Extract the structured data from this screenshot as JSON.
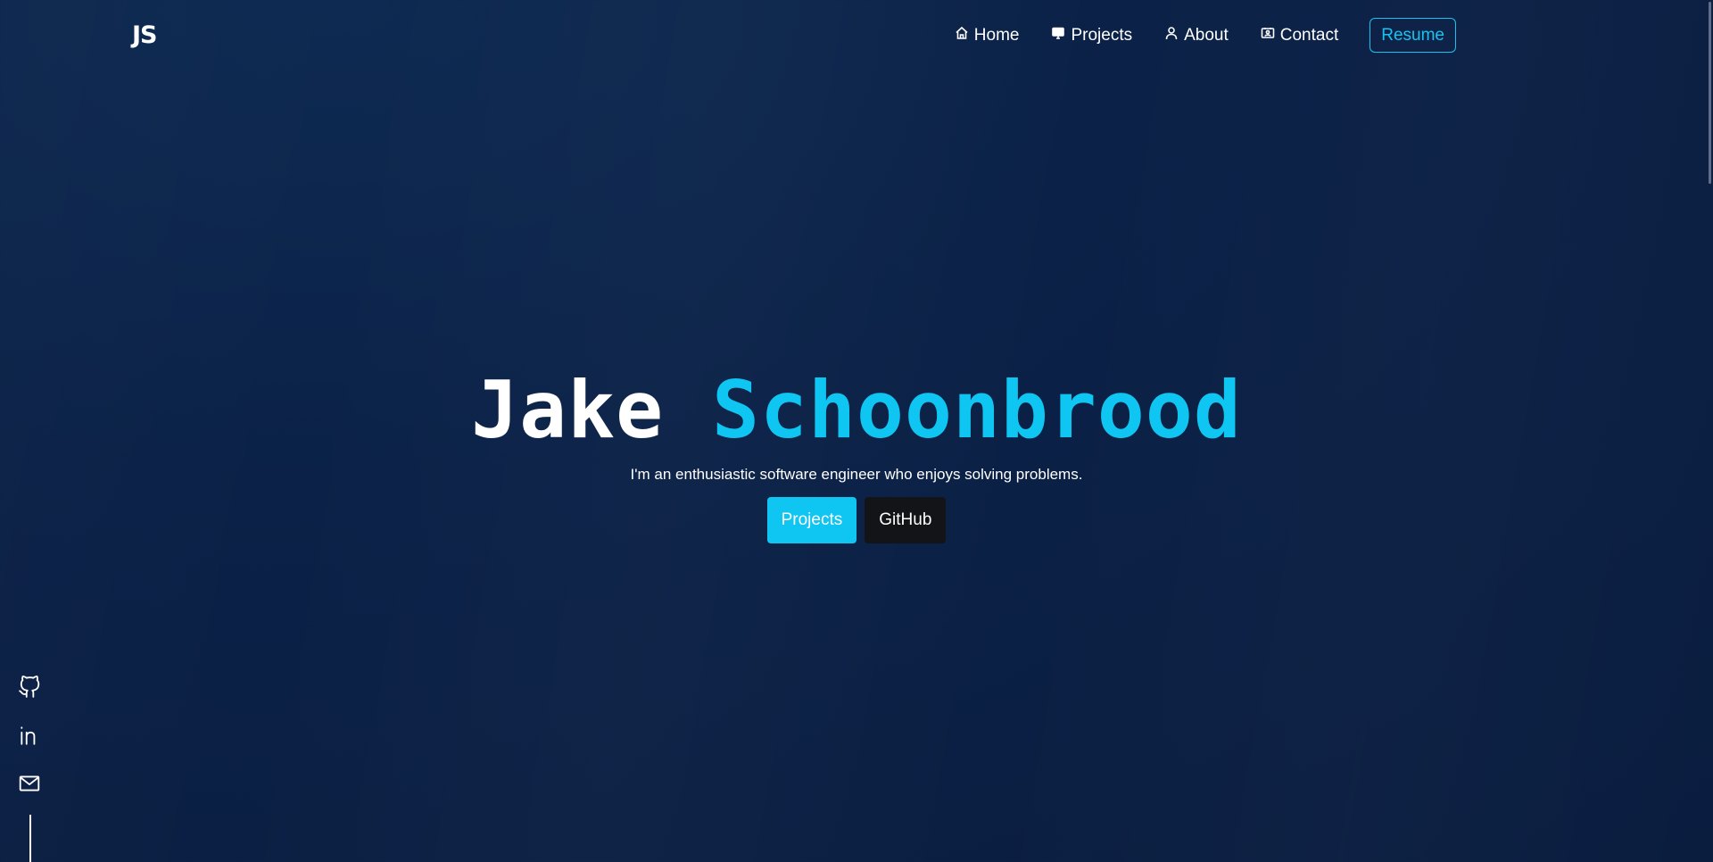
{
  "header": {
    "logo": "JS",
    "nav": [
      {
        "label": "Home",
        "icon": "home-icon"
      },
      {
        "label": "Projects",
        "icon": "monitor-icon"
      },
      {
        "label": "About",
        "icon": "user-icon"
      },
      {
        "label": "Contact",
        "icon": "contact-card-icon"
      }
    ],
    "resume_label": "Resume"
  },
  "hero": {
    "first_name": "Jake",
    "last_name": "Schoonbrood",
    "tagline": "I'm an enthusiastic software engineer who enjoys solving problems.",
    "primary_button": "Projects",
    "secondary_button": "GitHub"
  },
  "social": [
    {
      "icon": "github-icon"
    },
    {
      "icon": "linkedin-icon"
    },
    {
      "icon": "mail-icon"
    }
  ],
  "colors": {
    "accent": "#0fc6f2",
    "background": "#0b2147",
    "dark_button": "#121417"
  }
}
